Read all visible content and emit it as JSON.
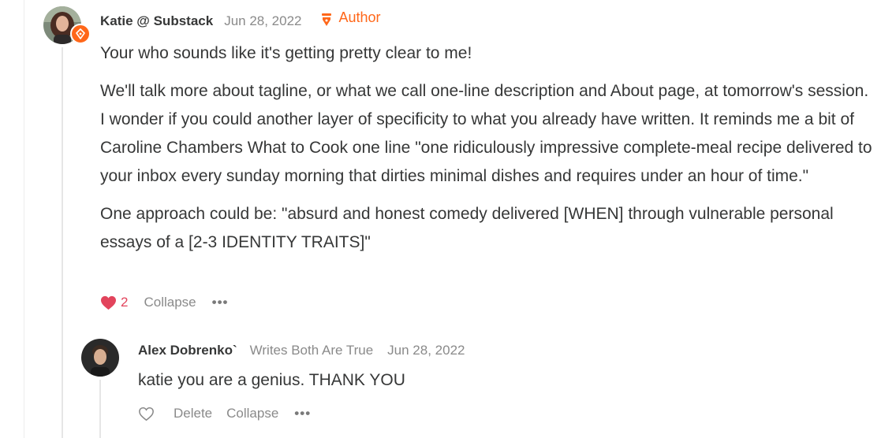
{
  "comment": {
    "author": "Katie @ Substack",
    "date": "Jun 28, 2022",
    "badge_label": "Author",
    "paragraphs": [
      "Your who sounds like it's getting pretty clear to me!",
      "We'll talk more about tagline, or what we call one-line description and About page, at tomorrow's session. I wonder if you could another layer of specificity to what you already have written. It reminds me a bit of Caroline Chambers What to Cook one line \"one ridiculously impressive complete-meal recipe delivered to your inbox every sunday morning that dirties minimal dishes and requires under an hour of time.\"",
      "One approach could be: \"absurd and honest comedy delivered [WHEN] through vulnerable personal essays of a [2-3 IDENTITY TRAITS]\""
    ],
    "like_count": "2",
    "collapse_label": "Collapse",
    "more_label": "•••"
  },
  "reply": {
    "author": "Alex Dobrenko`",
    "publication": "Writes Both Are True",
    "date": "Jun 28, 2022",
    "text": "katie you are a genius. THANK YOU",
    "delete_label": "Delete",
    "collapse_label": "Collapse",
    "more_label": "•••"
  },
  "colors": {
    "accent": "#ff6719",
    "like": "#e2445c",
    "muted": "#8a8a8a",
    "text": "#363737",
    "thread_line": "#e6e6e6"
  },
  "icons": {
    "author_badge": "pen-nib-icon",
    "like": "heart-filled-icon",
    "reply_like": "heart-outline-icon",
    "more": "ellipsis-icon"
  }
}
